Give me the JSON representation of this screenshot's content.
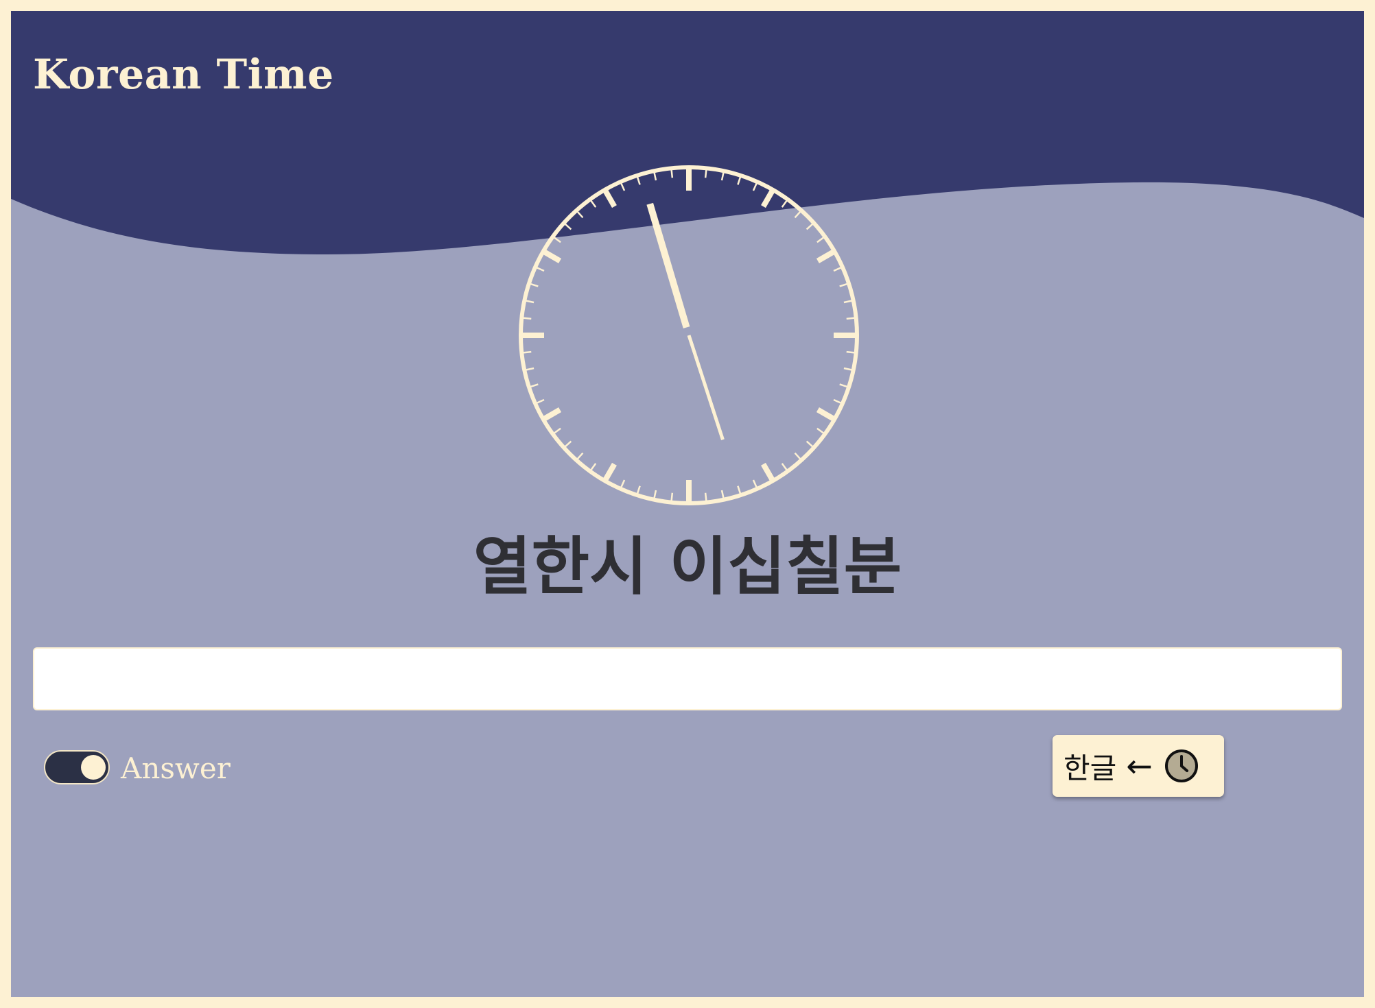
{
  "header": {
    "title": "Korean Time"
  },
  "clock": {
    "hour": 11,
    "minute": 27,
    "face_color": "#fdf1d3"
  },
  "time_text": "열한시 이십칠분",
  "answer_input": {
    "value": "",
    "placeholder": ""
  },
  "answer_toggle": {
    "label": "Answer",
    "checked": true
  },
  "mode_button": {
    "label": "한글",
    "arrow": "←",
    "icon": "clock-icon"
  },
  "colors": {
    "frame": "#fdf1d3",
    "header_band": "#363a6d",
    "background": "#9da1bd",
    "text_dark": "#2f2f34"
  }
}
